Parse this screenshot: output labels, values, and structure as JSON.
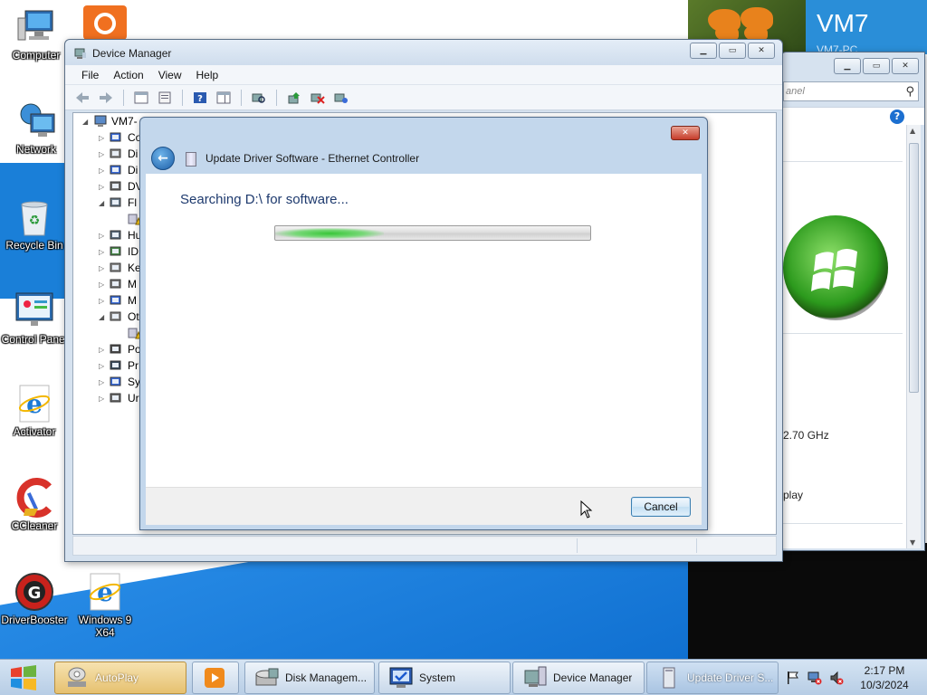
{
  "desktop": {
    "icons": [
      {
        "label": "Computer",
        "icon": "computer-icon"
      },
      {
        "label": "Network",
        "icon": "network-icon"
      },
      {
        "label": "Recycle Bin",
        "icon": "recycle-bin-icon"
      },
      {
        "label": "Control Panel",
        "icon": "control-panel-icon"
      },
      {
        "label": "Activator",
        "icon": "internet-explorer-icon"
      },
      {
        "label": "CCleaner",
        "icon": "ccleaner-icon"
      },
      {
        "label": "DriverBooster",
        "icon": "driver-booster-icon"
      },
      {
        "label": "Windows 9 X64",
        "icon": "internet-explorer-icon"
      }
    ],
    "banner_title": "VM7",
    "banner_subtitle": "VM7-PC"
  },
  "device_manager": {
    "title": "Device Manager",
    "menu": [
      "File",
      "Action",
      "View",
      "Help"
    ],
    "tree": {
      "root": "VM7-",
      "nodes": [
        {
          "label": "Co",
          "expanded": false
        },
        {
          "label": "Di",
          "expanded": false
        },
        {
          "label": "Di",
          "expanded": false
        },
        {
          "label": "DV",
          "expanded": false
        },
        {
          "label": "Fl",
          "expanded": true
        },
        {
          "label": "",
          "expanded": null
        },
        {
          "label": "Hu",
          "expanded": false
        },
        {
          "label": "ID",
          "expanded": false
        },
        {
          "label": "Ke",
          "expanded": false
        },
        {
          "label": "M",
          "expanded": false
        },
        {
          "label": "M",
          "expanded": false
        },
        {
          "label": "Ot",
          "expanded": true
        },
        {
          "label": "",
          "expanded": null
        },
        {
          "label": "Po",
          "expanded": false
        },
        {
          "label": "Pr",
          "expanded": false
        },
        {
          "label": "Sy",
          "expanded": false
        },
        {
          "label": "Ur",
          "expanded": false
        }
      ]
    }
  },
  "system_window": {
    "search_placeholder": "anel",
    "processor_speed": "2.70 GHz",
    "display_text": "play"
  },
  "update_dialog": {
    "title": "Update Driver Software - Ethernet Controller",
    "status": "Searching D:\\ for software...",
    "progress_state": "indeterminate",
    "cancel_label": "Cancel"
  },
  "taskbar": {
    "tasks": [
      {
        "label": "AutoPlay",
        "icon": "autoplay-icon"
      },
      {
        "label": "",
        "icon": "media-player-icon"
      },
      {
        "label": "Disk Managem...",
        "icon": "disk-management-icon"
      },
      {
        "label": "System",
        "icon": "system-icon"
      },
      {
        "label": "Device Manager",
        "icon": "device-manager-icon"
      },
      {
        "label": "Update Driver S...",
        "icon": "update-driver-icon"
      }
    ],
    "clock_time": "2:17 PM",
    "clock_date": "10/3/2024"
  },
  "colors": {
    "accent_blue": "#1a7fd8",
    "progress_green": "#38c638",
    "close_red": "#c63c2a",
    "dialog_text": "#1e3a6e"
  }
}
